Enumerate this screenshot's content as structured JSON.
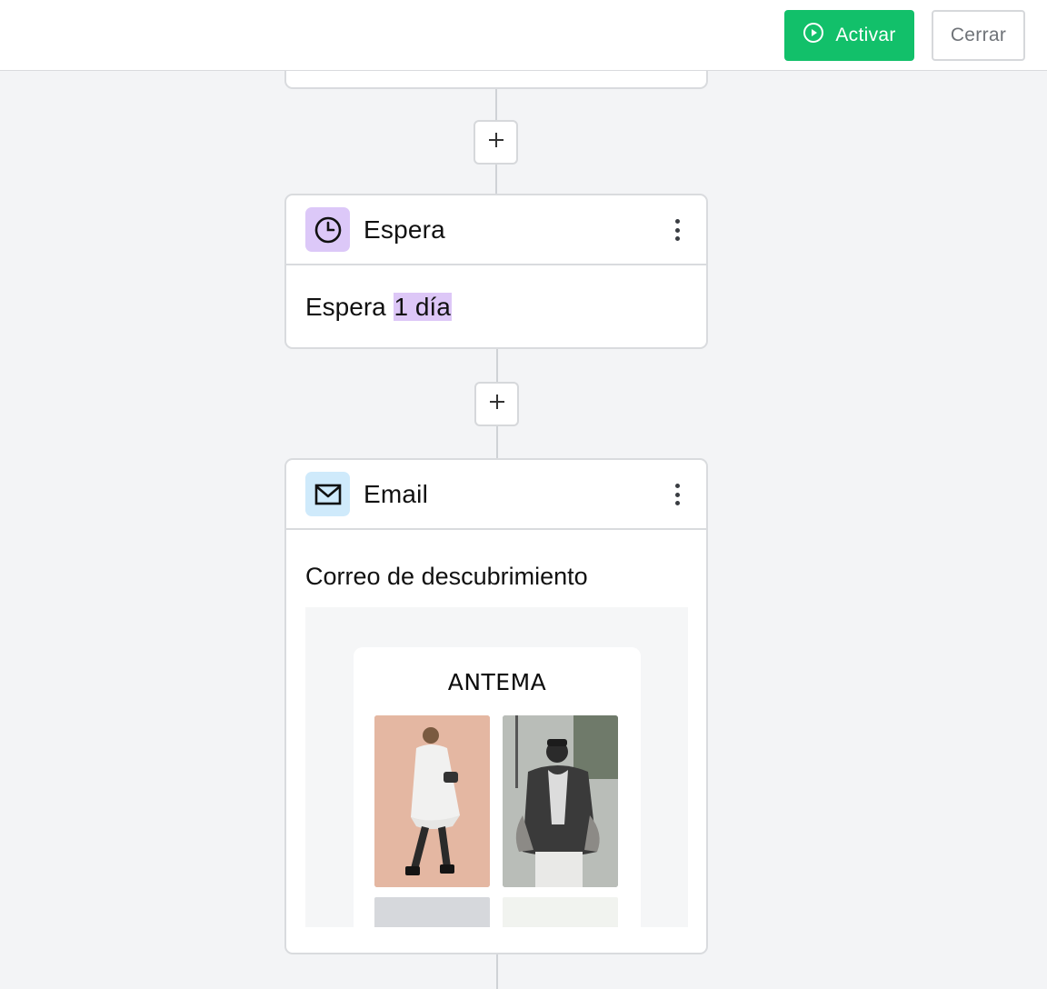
{
  "toolbar": {
    "activate_label": "Activar",
    "close_label": "Cerrar",
    "accent_color": "#12c06a"
  },
  "steps": [
    {
      "type": "wait",
      "title": "Espera",
      "icon": "clock-icon",
      "icon_bg": "#dcc8f8",
      "text_prefix": "Espera",
      "highlight": "1 día"
    },
    {
      "type": "email",
      "title": "Email",
      "icon": "envelope-icon",
      "icon_bg": "#cfeafb",
      "subject": "Correo de descubrimiento",
      "preview": {
        "brand": "ANTEMA"
      }
    }
  ]
}
